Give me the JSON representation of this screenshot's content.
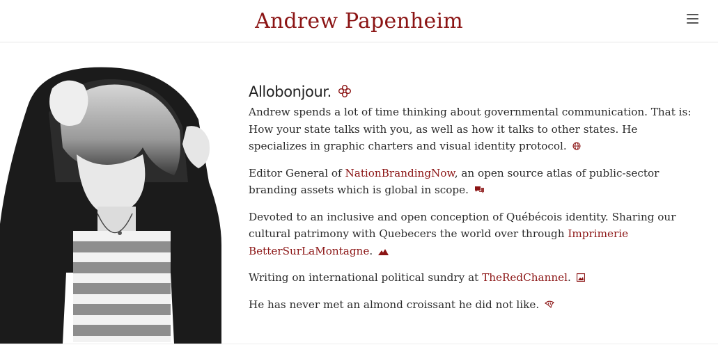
{
  "header": {
    "site_title": "Andrew Papenheim",
    "menu_icon": "hamburger-menu-icon"
  },
  "colors": {
    "accent": "#8b1414",
    "text": "#2a2a2a"
  },
  "main": {
    "greeting": "Allobonjour.",
    "greeting_icon": "fleur-de-lis-icon",
    "para1": {
      "text": "Andrew spends a lot of time thinking about governmental communication. That is: How your state talks with you, as well as how it talks to other states. He specializes in graphic charters and visual identity protocol.",
      "icon": "globe-icon"
    },
    "para2": {
      "before": "Editor General of ",
      "link": "NationBrandingNow",
      "after": ", an open source atlas of public-sector branding assets which is global in scope.",
      "icon": "speech-bubbles-icon"
    },
    "para3": {
      "before": "Devoted to an inclusive and open conception of Québécois identity. Sharing our cultural patrimony with Quebecers the world over through ",
      "link": "Imprimerie BetterSurLaMontagne",
      "after": ".",
      "icon": "mountain-icon"
    },
    "para4": {
      "before": "Writing on international political sundry at ",
      "link": "TheRedChannel",
      "after": ".",
      "icon": "image-frame-icon"
    },
    "para5": {
      "text": "He has never met an almond croissant he did not like.",
      "icon": "croissant-icon"
    }
  }
}
